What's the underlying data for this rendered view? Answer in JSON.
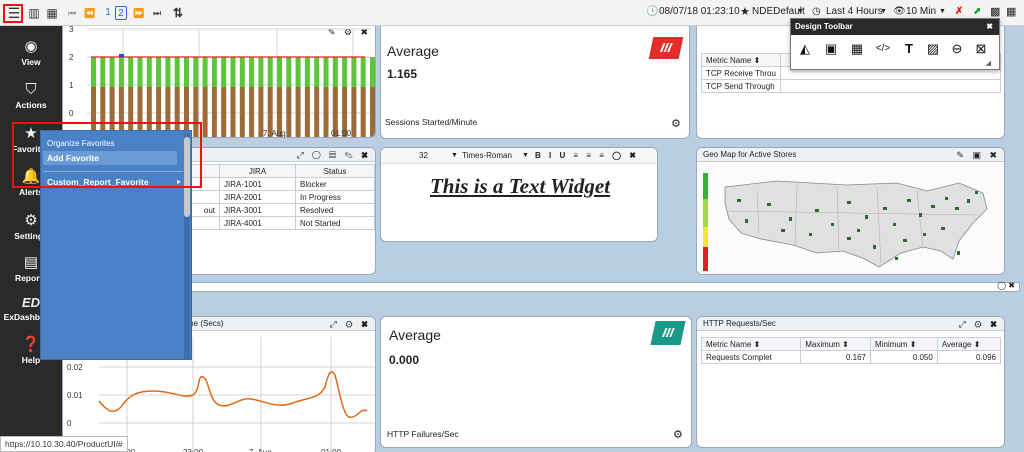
{
  "topbar": {
    "pages": [
      "1",
      "2"
    ],
    "datetime": "08/07/18 01:23:10",
    "favorite": "NDEDefault",
    "range": "Last 4 Hours",
    "interval": "10 Min"
  },
  "sidebar": [
    {
      "label": "View",
      "icon": "eye-icon",
      "glyph": "◉"
    },
    {
      "label": "Actions",
      "icon": "shield-icon",
      "glyph": "⛉"
    },
    {
      "label": "Favorites",
      "icon": "star-icon",
      "glyph": "★"
    },
    {
      "label": "Alerts",
      "icon": "bell-icon",
      "glyph": "🔔"
    },
    {
      "label": "Settings",
      "icon": "gear-icon",
      "glyph": "⚙"
    },
    {
      "label": "Reports",
      "icon": "report-icon",
      "glyph": "▤"
    },
    {
      "label": "ExDashboard",
      "icon": "exdashboard-icon",
      "glyph": "ED"
    },
    {
      "label": "Help",
      "icon": "help-icon",
      "glyph": "?"
    }
  ],
  "favmenu": {
    "title": "Organize Favorites",
    "add": "Add Favorite",
    "custom": "Custom_Report_Favorite"
  },
  "bar_chart": {
    "y_ticks": [
      "3",
      "2",
      "1",
      "0"
    ],
    "x_ticks": [
      "7. Aug",
      "01:00"
    ]
  },
  "avg_widget_1": {
    "title": "Average",
    "value": "1.165",
    "footer": "Sessions Started/Minute"
  },
  "avg_widget_2": {
    "title": "Average",
    "value": "0.000",
    "footer": "HTTP Failures/Sec"
  },
  "top_table": {
    "headers": [
      "Metric Name",
      ""
    ],
    "rows": [
      "TCP Receive Throu",
      "TCP Send Through"
    ]
  },
  "jira_table": {
    "headers": [
      "JIRA",
      "Status"
    ],
    "rows": [
      {
        "id": "JIRA-1001",
        "status": "Blocker"
      },
      {
        "id": "JIRA-2001",
        "status": "In Progress"
      },
      {
        "id": "JIRA-3001",
        "status": "Resolved"
      },
      {
        "id": "JIRA-4001",
        "status": "Not Started"
      }
    ],
    "partial": [
      "",
      "",
      "out",
      ""
    ]
  },
  "text_widget": {
    "font_size": "32",
    "font": "Times-Roman",
    "text": "This is a Text Widget"
  },
  "geo_map": {
    "title": "Geo Map for Active Stores"
  },
  "line_chart": {
    "title": "me (Secs)",
    "y_ticks": [
      "0.02",
      "0.01",
      "0"
    ],
    "x_ticks": [
      "23:00",
      "23:00",
      "7. Aug",
      "01:00"
    ]
  },
  "http_table": {
    "title": "HTTP Requests/Sec",
    "headers": [
      "Metric Name",
      "Maximum",
      "Minimum",
      "Average"
    ],
    "row": [
      "Requests Complet",
      "0.167",
      "0.050",
      "0.096"
    ]
  },
  "design_toolbar": {
    "title": "Design Toolbar",
    "icons": [
      "area-chart-icon",
      "widget-icon",
      "table-icon",
      "code-icon",
      "text-icon",
      "image-icon",
      "minus-icon",
      "close-icon"
    ]
  },
  "status_url": "https://10.10.30.40/ProductUI/#"
}
